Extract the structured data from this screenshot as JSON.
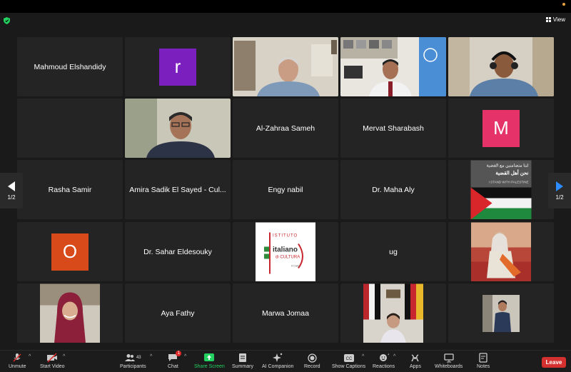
{
  "view": {
    "label": "View"
  },
  "pager": {
    "left": "1/2",
    "right": "1/2"
  },
  "tiles": {
    "t1": "Mahmoud Elshandidy",
    "t2_avatar": "r",
    "t8": "Al-Zahraa Sameh",
    "t9": "Mervat Sharabash",
    "t10_avatar": "M",
    "t11": "Rasha Samir",
    "t12": "Amira Sadik El Sayed - Cul...",
    "t13": "Engy nabil",
    "t14": "Dr. Maha Aly",
    "t15_l1": "لننا متضامنين مع القضية",
    "t15_l2": "نحن أهل القضية",
    "t15_l3": "I STAND WITH PALESTINE",
    "t16_avatar": "O",
    "t17": "Dr. Sahar Eldesouky",
    "t18_l1": "ISTITUTO",
    "t18_l2": "italiano",
    "t18_l3": "di CULTURA",
    "t18_l4": "il Cairo",
    "t19": "ug",
    "t22": "Aya Fathy",
    "t23": "Marwa Jomaa"
  },
  "colors": {
    "avatar_r": "#7c1fbf",
    "avatar_m": "#e5336a",
    "avatar_o": "#d94a1a",
    "active_border": "#23d160",
    "leave": "#d3302f",
    "share": "#23d160"
  },
  "toolbar": {
    "unmute": "Unmute",
    "start_video": "Start Video",
    "participants": "Participants",
    "participant_count": "43",
    "chat": "Chat",
    "chat_badge": "1",
    "share": "Share Screen",
    "summary": "Summary",
    "ai": "AI Companion",
    "record": "Record",
    "captions": "Show Captions",
    "reactions": "Reactions",
    "apps": "Apps",
    "whiteboards": "Whiteboards",
    "notes": "Notes",
    "leave": "Leave"
  }
}
